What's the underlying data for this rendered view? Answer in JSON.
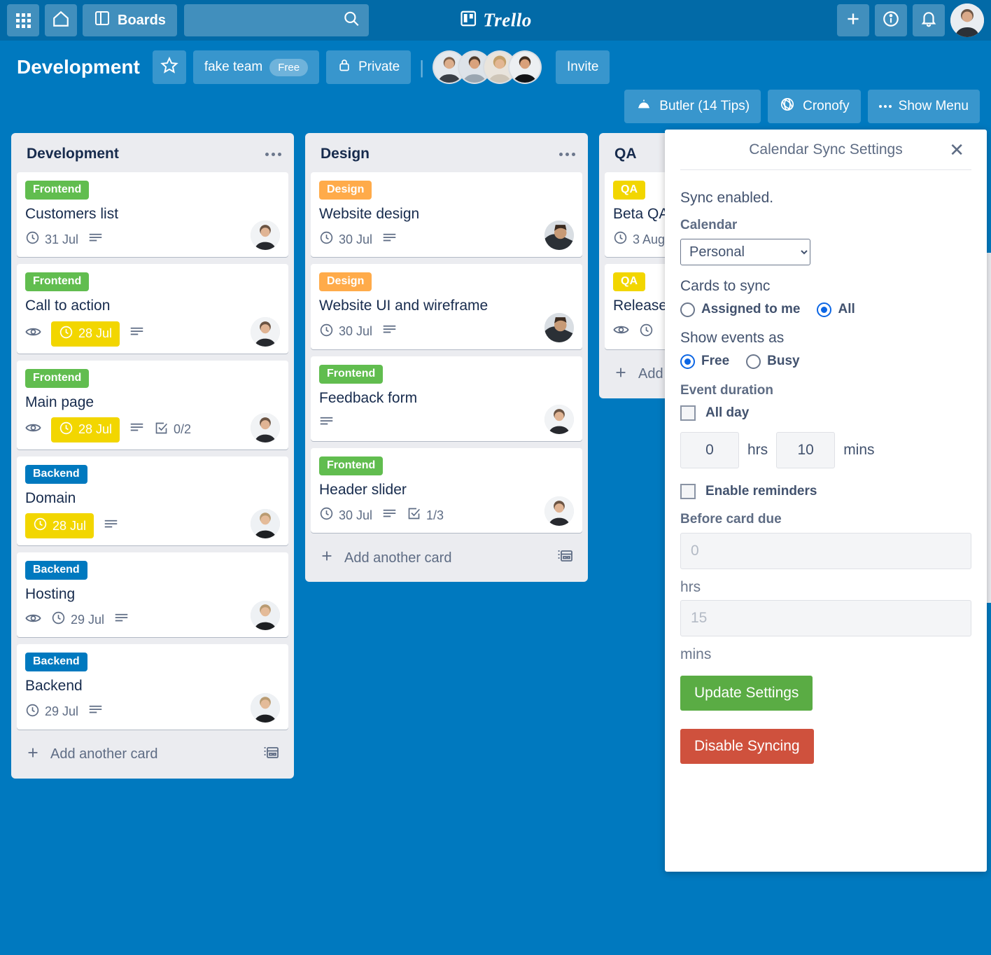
{
  "nav": {
    "boards_label": "Boards",
    "search_placeholder": "",
    "search_value": "",
    "logo_text": "Trello",
    "icons": {
      "apps": "apps-grid-icon",
      "home": "home-icon",
      "boards": "boards-icon",
      "search": "search-icon",
      "add": "plus-icon",
      "info": "info-icon",
      "notifications": "bell-icon",
      "avatar": "user-avatar"
    }
  },
  "board_header": {
    "title": "Development",
    "star_label": "★",
    "team_name": "fake team",
    "team_plan": "Free",
    "visibility": "Private",
    "invite_label": "Invite",
    "member_count": 4,
    "butler_label": "Butler (14 Tips)",
    "cronofy_label": "Cronofy",
    "show_menu_label": "Show Menu"
  },
  "lists": [
    {
      "name": "Development",
      "add_card_label": "Add another card",
      "cards": [
        {
          "label": "Frontend",
          "label_color": "#61BD4F",
          "title": "Customers list",
          "watching": false,
          "due": "31 Jul",
          "due_highlight": false,
          "description": true,
          "checklist": "",
          "avatar": "woman-1"
        },
        {
          "label": "Frontend",
          "label_color": "#61BD4F",
          "title": "Call to action",
          "watching": true,
          "due": "28 Jul",
          "due_highlight": true,
          "description": true,
          "checklist": "",
          "avatar": "woman-1"
        },
        {
          "label": "Frontend",
          "label_color": "#61BD4F",
          "title": "Main page",
          "watching": true,
          "due": "28 Jul",
          "due_highlight": true,
          "description": true,
          "checklist": "0/2",
          "avatar": "woman-1"
        },
        {
          "label": "Backend",
          "label_color": "#0079BF",
          "title": "Domain",
          "watching": false,
          "due": "28 Jul",
          "due_highlight": true,
          "description": true,
          "checklist": "",
          "avatar": "man-1"
        },
        {
          "label": "Backend",
          "label_color": "#0079BF",
          "title": "Hosting",
          "watching": true,
          "due": "29 Jul",
          "due_highlight": false,
          "description": true,
          "checklist": "",
          "avatar": "man-1"
        },
        {
          "label": "Backend",
          "label_color": "#0079BF",
          "title": "Backend",
          "watching": false,
          "due": "29 Jul",
          "due_highlight": false,
          "description": true,
          "checklist": "",
          "avatar": "man-1"
        }
      ]
    },
    {
      "name": "Design",
      "add_card_label": "Add another card",
      "cards": [
        {
          "label": "Design",
          "label_color": "#FFAB4A",
          "title": "Website design",
          "watching": false,
          "due": "30 Jul",
          "due_highlight": false,
          "description": true,
          "checklist": "",
          "avatar": "man-2"
        },
        {
          "label": "Design",
          "label_color": "#FFAB4A",
          "title": "Website UI and wireframe",
          "watching": false,
          "due": "30 Jul",
          "due_highlight": false,
          "description": true,
          "checklist": "",
          "avatar": "man-2"
        },
        {
          "label": "Frontend",
          "label_color": "#61BD4F",
          "title": "Feedback form",
          "watching": false,
          "due": "",
          "due_highlight": false,
          "description": true,
          "checklist": "",
          "avatar": "woman-1"
        },
        {
          "label": "Frontend",
          "label_color": "#61BD4F",
          "title": "Header slider",
          "watching": false,
          "due": "30 Jul",
          "due_highlight": false,
          "description": true,
          "checklist": "1/3",
          "avatar": "woman-1"
        }
      ]
    },
    {
      "name": "QA",
      "add_card_label": "Add another card",
      "cards": [
        {
          "label": "QA",
          "label_color": "#F2D600",
          "title": "Beta QA",
          "watching": false,
          "due": "3 Aug",
          "due_highlight": false,
          "description": false,
          "checklist": "",
          "avatar": ""
        },
        {
          "label": "QA",
          "label_color": "#F2D600",
          "title": "Release",
          "watching": true,
          "due": " ",
          "due_highlight": false,
          "description": false,
          "checklist": "",
          "avatar": ""
        }
      ]
    }
  ],
  "panel": {
    "title": "Calendar Sync Settings",
    "close_label": "✕",
    "sync_status": "Sync enabled.",
    "calendar_label": "Calendar",
    "calendar_value": "Personal",
    "calendar_options": [
      "Personal"
    ],
    "cards_to_sync_label": "Cards to sync",
    "cards_to_sync_options": [
      {
        "label": "Assigned to me",
        "selected": false
      },
      {
        "label": "All",
        "selected": true
      }
    ],
    "show_events_label": "Show events as",
    "show_events_options": [
      {
        "label": "Free",
        "selected": true
      },
      {
        "label": "Busy",
        "selected": false
      }
    ],
    "event_duration_label": "Event duration",
    "all_day_label": "All day",
    "all_day_checked": false,
    "duration_hrs": "0",
    "duration_hrs_unit": "hrs",
    "duration_mins": "10",
    "duration_mins_unit": "mins",
    "enable_reminders_label": "Enable reminders",
    "enable_reminders_checked": false,
    "before_card_due_label": "Before card due",
    "reminder_hrs_placeholder": "0",
    "reminder_hrs_unit": "hrs",
    "reminder_mins_placeholder": "15",
    "reminder_mins_unit": "mins",
    "update_button": "Update Settings",
    "disable_button": "Disable Syncing"
  },
  "colors": {
    "nav_bg": "#026AA7",
    "board_bg": "#0079BF",
    "list_bg": "#EBECF0",
    "green": "#61BD4F",
    "blue": "#0079BF",
    "orange": "#FFAB4A",
    "yellow": "#F2D600",
    "btn_green": "#5AAC44",
    "btn_red": "#CF513D",
    "radio_blue": "#0C66E4"
  }
}
